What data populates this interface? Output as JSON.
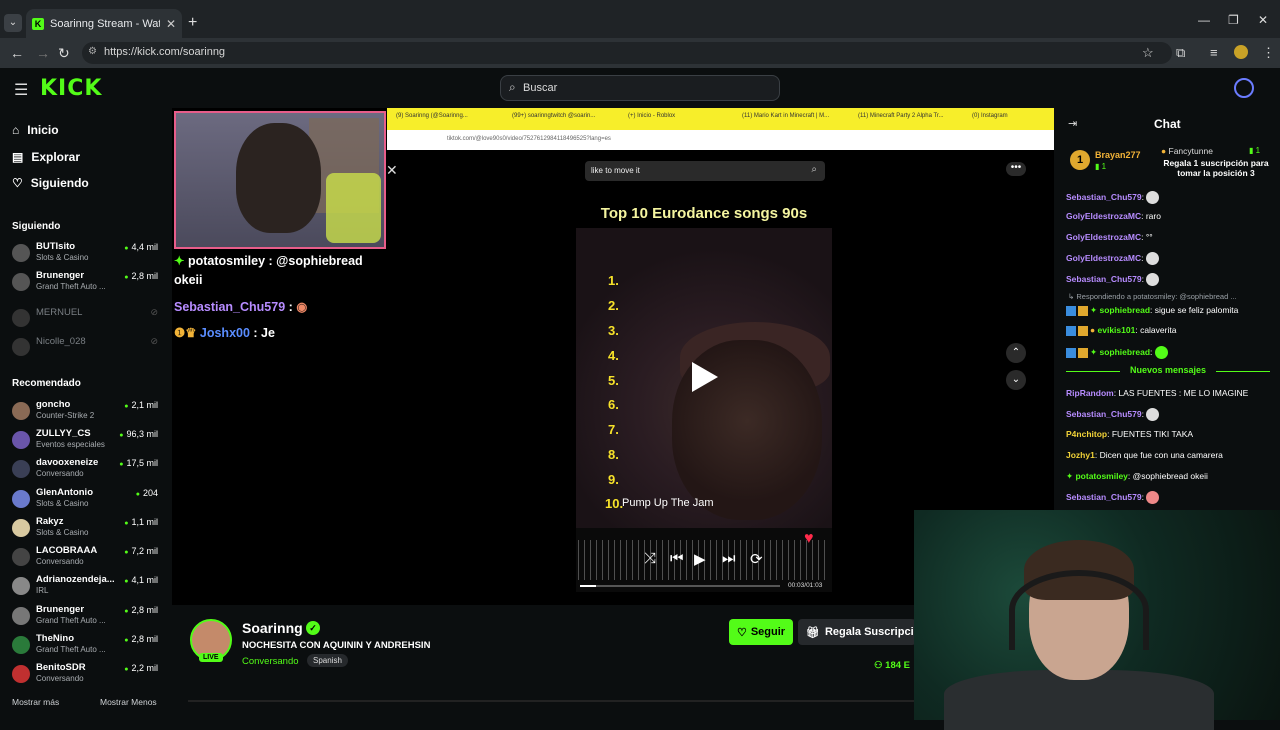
{
  "browser": {
    "tab_title": "Soarinng Stream - Watch L",
    "url": "https://kick.com/soarinng"
  },
  "header": {
    "logo": "KICK",
    "search_placeholder": "Buscar"
  },
  "sidebar": {
    "nav": [
      {
        "label": "Inicio",
        "icon": "home-icon"
      },
      {
        "label": "Explorar",
        "icon": "explore-icon"
      },
      {
        "label": "Siguiendo",
        "icon": "heart-icon"
      }
    ],
    "following_label": "Siguiendo",
    "following": [
      {
        "name": "BUTIsito",
        "game": "Slots & Casino",
        "viewers": "4,4 mil",
        "online": true
      },
      {
        "name": "Brunenger",
        "game": "Grand Theft Auto ...",
        "viewers": "2,8 mil",
        "online": true
      },
      {
        "name": "MERNUEL",
        "game": "",
        "viewers": "",
        "online": false
      },
      {
        "name": "Nicolle_028",
        "game": "",
        "viewers": "",
        "online": false
      }
    ],
    "recommended_label": "Recomendado",
    "recommended": [
      {
        "name": "goncho",
        "game": "Counter-Strike 2",
        "viewers": "2,1 mil"
      },
      {
        "name": "ZULLYY_CS",
        "game": "Eventos especiales",
        "viewers": "96,3 mil"
      },
      {
        "name": "davooxeneize",
        "game": "Conversando",
        "viewers": "17,5 mil"
      },
      {
        "name": "GlenAntonio",
        "game": "Slots & Casino",
        "viewers": "204"
      },
      {
        "name": "Rakyz",
        "game": "Slots & Casino",
        "viewers": "1,1 mil"
      },
      {
        "name": "LACOBRAAA",
        "game": "Conversando",
        "viewers": "7,2 mil"
      },
      {
        "name": "Adrianozendeja...",
        "game": "IRL",
        "viewers": "4,1 mil"
      },
      {
        "name": "Brunenger",
        "game": "Grand Theft Auto ...",
        "viewers": "2,8 mil"
      },
      {
        "name": "TheNino",
        "game": "Grand Theft Auto ...",
        "viewers": "2,8 mil"
      },
      {
        "name": "BenitoSDR",
        "game": "Conversando",
        "viewers": "2,2 mil"
      }
    ],
    "show_more": "Mostrar más",
    "show_less": "Mostrar Menos"
  },
  "stream_overlay": {
    "chat": [
      {
        "user": "potatosmiley",
        "text": ": @sophiebread okeii"
      },
      {
        "user": "Sebastian_Chu579",
        "text": ":"
      },
      {
        "user": "Joshx00",
        "text": ": Je"
      }
    ],
    "inner_tabs": [
      "(9) Soarinng (@Soarinng...",
      "(99+) soarinngtwitch @soarin...",
      "(+) Inicio - Roblox",
      "(11) Mario Kart in Minecraft | M...",
      "(11) Minecraft Party 2 Alpha Tr...",
      "(0) Instagram"
    ],
    "inner_url": "tiktok.com/@love90s0/video/7527612984118496525?lang=es",
    "tiktok_search": "like to move it",
    "tiktok_title": "Top 10 Eurodance songs 90s",
    "ranks": [
      "1.",
      "2.",
      "3.",
      "4.",
      "5.",
      "6.",
      "7.",
      "8.",
      "9.",
      "10."
    ],
    "song": "Pump Up The Jam",
    "time": "00:03/01:03"
  },
  "channel": {
    "name": "Soarinng",
    "title": "NOCHESITA CON AQUININ Y ANDREHSIN",
    "category": "Conversando",
    "language": "Spanish",
    "live": "LIVE",
    "follow_label": "Seguir",
    "gift_label": "Regala Suscripcio",
    "viewers": "184 E"
  },
  "chat": {
    "title": "Chat",
    "pinned": {
      "user1": "Brayan277",
      "count1": "1",
      "user2": "Fancytunne",
      "count2": "1",
      "message": "Regala 1 suscripción para tomar la posición 3"
    },
    "messages": [
      {
        "user": "Sebastian_Chu579",
        "text": "",
        "color": "#b78cff"
      },
      {
        "user": "GolyEldestrozaMC",
        "text": "raro",
        "color": "#b78cff"
      },
      {
        "user": "GolyEldestrozaMC",
        "text": "",
        "color": "#b78cff"
      },
      {
        "user": "GolyEldestrozaMC",
        "text": "",
        "color": "#b78cff"
      },
      {
        "user": "Sebastian_Chu579",
        "text": "",
        "color": "#b78cff"
      },
      {
        "user": "sophiebread",
        "text": "sigue se feliz palomita",
        "color": "#53fc18"
      },
      {
        "user": "evikis101",
        "text": "calaverita",
        "color": "#53fc18"
      },
      {
        "user": "sophiebread",
        "text": "",
        "color": "#53fc18"
      },
      {
        "user": "RipRandom",
        "text": "LAS FUENTES : ME LO IMAGINE",
        "color": "#b78cff"
      },
      {
        "user": "Sebastian_Chu579",
        "text": "",
        "color": "#b78cff"
      },
      {
        "user": "P4nchitop",
        "text": "FUENTES TIKI TAKA",
        "color": "#f2d338"
      },
      {
        "user": "Jozhy1",
        "text": "Dicen que fue con una camarera",
        "color": "#f2d338"
      },
      {
        "user": "potatosmiley",
        "text": "@sophiebread okeii",
        "color": "#53fc18"
      },
      {
        "user": "Sebastian_Chu579",
        "text": "",
        "color": "#b78cff"
      }
    ],
    "reply_to": "Respondiendo a potatosmiley: @sophiebread ...",
    "new_messages": "Nuevos mensajes"
  }
}
